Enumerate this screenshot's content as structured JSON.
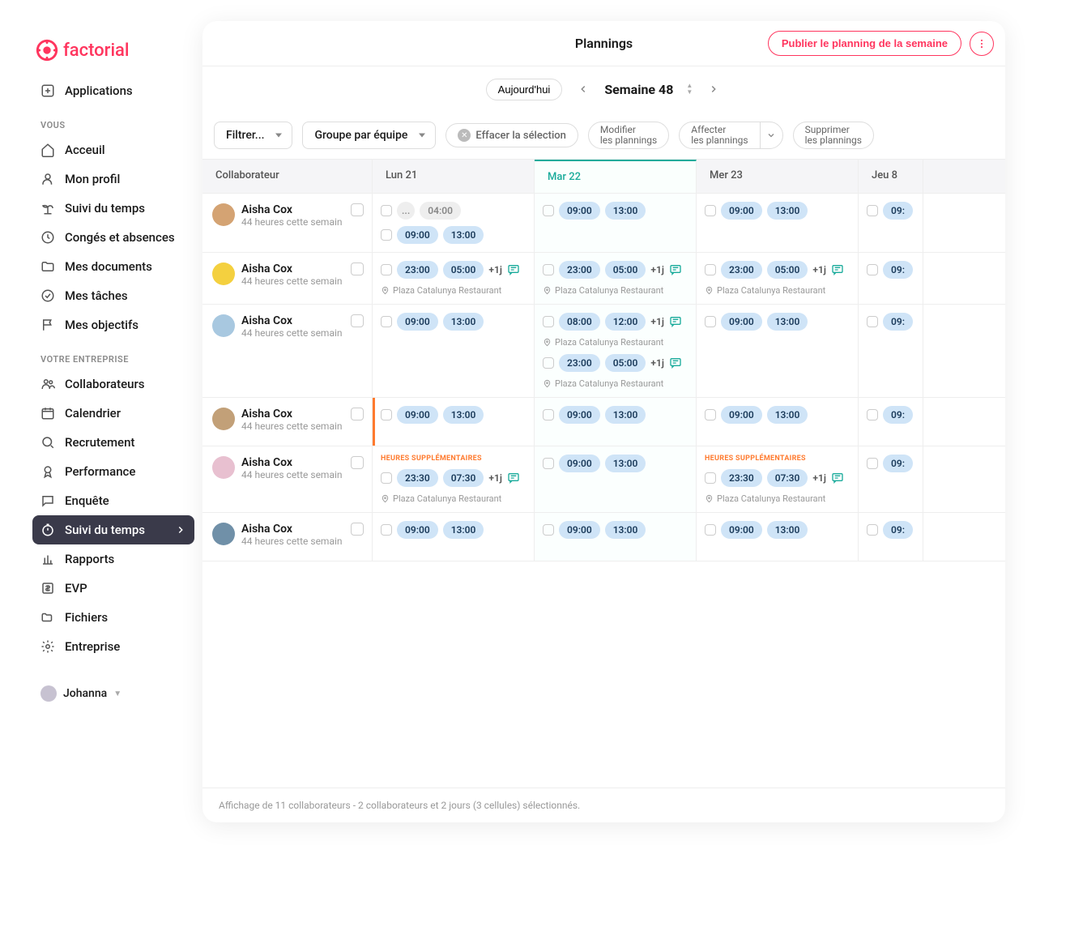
{
  "logo": "factorial",
  "nav_apps": "Applications",
  "nav_sections": {
    "vous": {
      "label": "VOUS",
      "items": [
        {
          "label": "Acceuil"
        },
        {
          "label": "Mon profil"
        },
        {
          "label": "Suivi du temps"
        },
        {
          "label": "Congés et absences"
        },
        {
          "label": "Mes documents"
        },
        {
          "label": "Mes tâches"
        },
        {
          "label": "Mes objectifs"
        }
      ]
    },
    "entreprise": {
      "label": "VOTRE ENTREPRISE",
      "items": [
        {
          "label": "Collaborateurs"
        },
        {
          "label": "Calendrier"
        },
        {
          "label": "Recrutement"
        },
        {
          "label": "Performance"
        },
        {
          "label": "Enquête"
        },
        {
          "label": "Suivi du temps",
          "active": true
        },
        {
          "label": "Rapports"
        },
        {
          "label": "EVP"
        },
        {
          "label": "Fichiers"
        },
        {
          "label": "Entreprise"
        }
      ]
    }
  },
  "user_name": "Johanna",
  "topbar_title": "Plannings",
  "publish_label": "Publier le planning de la semaine",
  "today_label": "Aujourd'hui",
  "week_label": "Semaine 48",
  "toolbar": {
    "filter": "Filtrer...",
    "group": "Groupe par équipe",
    "clear": "Effacer la sélection",
    "modify_l1": "Modifier",
    "modify_l2": "les plannings",
    "assign_l1": "Affecter",
    "assign_l2": "les plannings",
    "delete_l1": "Supprimer",
    "delete_l2": "les plannings"
  },
  "columns": {
    "collab": "Collaborateur",
    "d1": "Lun 21",
    "d2": "Mar 22",
    "d3": "Mer 23",
    "d4": "Jeu 8"
  },
  "shared": {
    "location": "Plaza Catalunya Restaurant",
    "overtime": "HEURES SUPPLÉMENTAIRES",
    "t0900": "09:00",
    "t1300": "13:00",
    "t2300": "23:00",
    "t0500": "05:00",
    "t0800": "08:00",
    "t1200": "12:00",
    "t2330": "23:30",
    "t0730": "07:30",
    "t0400": "04:00",
    "plus1j": "+1j",
    "dots": "..."
  },
  "rows": [
    {
      "name": "Aisha Cox",
      "sub": "44 heures cette semain"
    },
    {
      "name": "Aisha Cox",
      "sub": "44 heures cette semain"
    },
    {
      "name": "Aisha Cox",
      "sub": "44 heures cette semain"
    },
    {
      "name": "Aisha Cox",
      "sub": "44 heures cette semain"
    },
    {
      "name": "Aisha Cox",
      "sub": "44 heures cette semain"
    },
    {
      "name": "Aisha Cox",
      "sub": "44 heures cette semain"
    }
  ],
  "footer": "Affichage de 11 collaborateurs - 2 collaborateurs et 2 jours (3 cellules) sélectionnés."
}
